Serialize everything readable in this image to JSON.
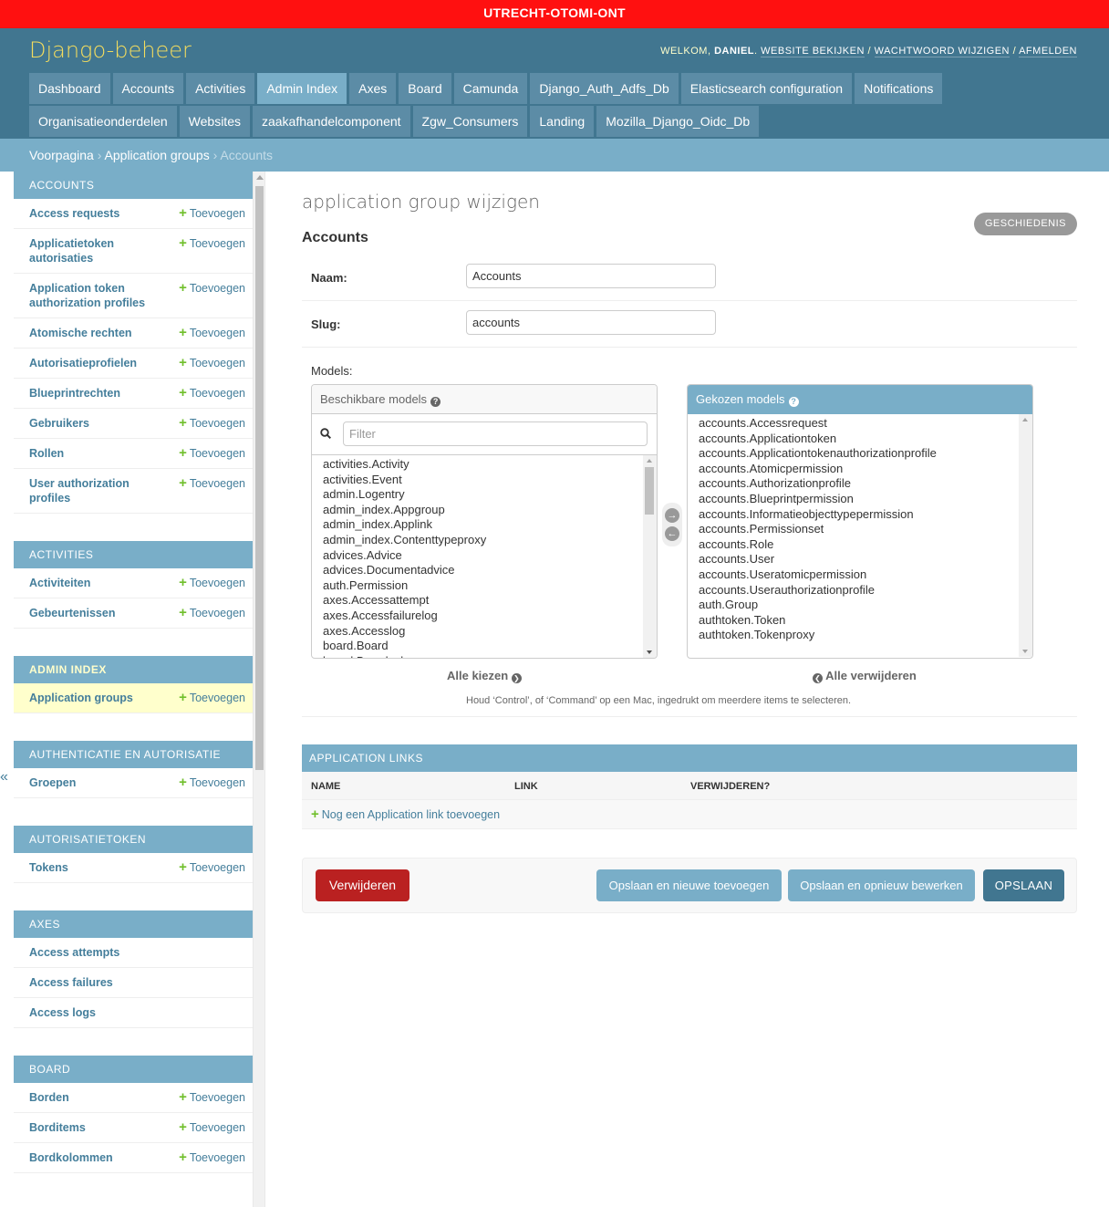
{
  "environment": "UTRECHT-OTOMI-ONT",
  "header": {
    "brand": "Django-beheer",
    "welcome": "WELKOM,",
    "username": "DANIEL",
    "links": [
      "WEBSITE BEKIJKEN",
      "WACHTWOORD WIJZIGEN",
      "AFMELDEN"
    ]
  },
  "nav": {
    "row1": [
      "Dashboard",
      "Accounts",
      "Activities",
      "Admin Index",
      "Axes",
      "Board",
      "Camunda",
      "Django_Auth_Adfs_Db",
      "Elasticsearch configuration",
      "Notifications"
    ],
    "row2": [
      "Organisatieonderdelen",
      "Websites",
      "zaakafhandelcomponent",
      "Zgw_Consumers",
      "Landing",
      "Mozilla_Django_Oidc_Db"
    ],
    "active": "Admin Index"
  },
  "breadcrumbs": {
    "home": "Voorpagina",
    "sep": "›",
    "section": "Application groups",
    "current": "Accounts"
  },
  "sidebar": {
    "add_label": "Toevoegen",
    "modules": [
      {
        "caption": "Accounts",
        "rows": [
          "Access requests",
          "Applicatietoken autorisaties",
          "Application token authorization profiles",
          "Atomische rechten",
          "Autorisatieprofielen",
          "Blueprintrechten",
          "Gebruikers",
          "Rollen",
          "User authorization profiles"
        ]
      },
      {
        "caption": "Activities",
        "rows": [
          "Activiteiten",
          "Gebeurtenissen"
        ]
      },
      {
        "caption": "Admin Index",
        "rows": [
          "Application groups"
        ]
      },
      {
        "caption": "Authenticatie en autorisatie",
        "rows": [
          "Groepen"
        ]
      },
      {
        "caption": "Autorisatietoken",
        "rows": [
          "Tokens"
        ]
      },
      {
        "caption": "Axes",
        "rows": [
          "Access attempts",
          "Access failures",
          "Access logs"
        ]
      },
      {
        "caption": "Board",
        "rows": [
          "Borden",
          "Borditems",
          "Bordkolommen"
        ]
      }
    ],
    "collapse": "«"
  },
  "page": {
    "title": "application group wijzigen",
    "history": "GESCHIEDENIS",
    "object_title": "Accounts",
    "fields": {
      "name_label": "Naam:",
      "name_value": "Accounts",
      "slug_label": "Slug:",
      "slug_value": "accounts"
    },
    "models_label": "Models:",
    "available_title": "Beschikbare models",
    "chosen_title": "Gekozen models",
    "filter_placeholder": "Filter",
    "available": [
      "activities.Activity",
      "activities.Event",
      "admin.Logentry",
      "admin_index.Appgroup",
      "admin_index.Applink",
      "admin_index.Contenttypeproxy",
      "advices.Advice",
      "advices.Documentadvice",
      "auth.Permission",
      "axes.Accessattempt",
      "axes.Accessfailurelog",
      "axes.Accesslog",
      "board.Board",
      "board.Boardcolumn"
    ],
    "chosen": [
      "accounts.Accessrequest",
      "accounts.Applicationtoken",
      "accounts.Applicationtokenauthorizationprofile",
      "accounts.Atomicpermission",
      "accounts.Authorizationprofile",
      "accounts.Blueprintpermission",
      "accounts.Informatieobjecttypepermission",
      "accounts.Permissionset",
      "accounts.Role",
      "accounts.User",
      "accounts.Useratomicpermission",
      "accounts.Userauthorizationprofile",
      "auth.Group",
      "authtoken.Token",
      "authtoken.Tokenproxy"
    ],
    "choose_all": "Alle kiezen",
    "remove_all": "Alle verwijderen",
    "help_text": "Houd ‘Control’, of ‘Command’ op een Mac, ingedrukt om meerdere items te selecteren.",
    "inline": {
      "caption": "APPLICATION LINKS",
      "columns": [
        "NAME",
        "LINK",
        "VERWIJDEREN?"
      ],
      "add_label": "Nog een Application link toevoegen"
    },
    "buttons": {
      "delete": "Verwijderen",
      "save_add": "Opslaan en nieuwe toevoegen",
      "save_continue": "Opslaan en opnieuw bewerken",
      "save": "OPSLAAN"
    }
  }
}
